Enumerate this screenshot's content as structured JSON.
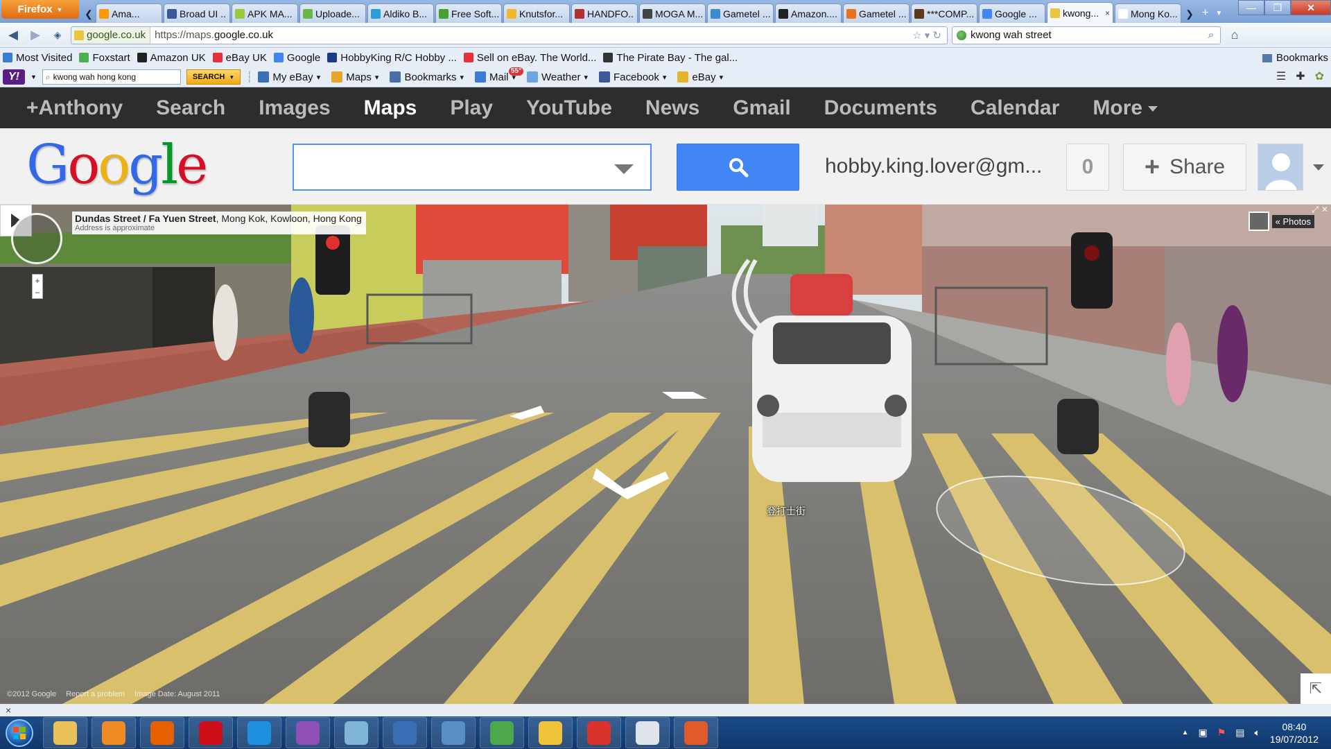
{
  "browser": {
    "app_menu_label": "Firefox",
    "tabs": [
      {
        "label": "Ama...",
        "icon": "amazon-icon",
        "color": "#f90"
      },
      {
        "label": "Broad UI ...",
        "icon": "facebook-icon",
        "color": "#3b5998"
      },
      {
        "label": "APK MA...",
        "icon": "android-icon",
        "color": "#9bc93c"
      },
      {
        "label": "Uploade...",
        "icon": "upload-icon",
        "color": "#6cb644"
      },
      {
        "label": "Aldiko B...",
        "icon": "play-store-icon",
        "color": "#2a9fd6"
      },
      {
        "label": "Free Soft...",
        "icon": "check-icon",
        "color": "#4aa02c"
      },
      {
        "label": "Knutsfor...",
        "icon": "shield-icon",
        "color": "#f3b82a"
      },
      {
        "label": "HANDFO...",
        "icon": "scissors-icon",
        "color": "#b03030"
      },
      {
        "label": "MOGA M...",
        "icon": "moga-icon",
        "color": "#444"
      },
      {
        "label": "Gametel ...",
        "icon": "gamepad-icon",
        "color": "#3a8bd0"
      },
      {
        "label": "Amazon....",
        "icon": "amazon-icon",
        "color": "#222"
      },
      {
        "label": "Gametel ...",
        "icon": "square-icon",
        "color": "#e8731a"
      },
      {
        "label": "***COMP...",
        "icon": "comp-icon",
        "color": "#5a3a1a"
      },
      {
        "label": "Google ...",
        "icon": "google-icon",
        "color": "#4285f4"
      },
      {
        "label": "kwong...",
        "icon": "maps-icon",
        "color": "#e8c640",
        "active": true,
        "close": "×"
      },
      {
        "label": "Mong Ko...",
        "icon": "wikipedia-icon",
        "color": "#fff"
      }
    ],
    "url_site": "google.co.uk",
    "url_prefix": "https://maps.",
    "url_domain": "google.co.uk",
    "search_value": "kwong wah street",
    "bookmarks": [
      {
        "label": "Most Visited",
        "color": "#3a7bd5"
      },
      {
        "label": "Foxstart",
        "color": "#4caf50"
      },
      {
        "label": "Amazon UK",
        "color": "#222"
      },
      {
        "label": "eBay UK",
        "color": "#e53238"
      },
      {
        "label": "Google",
        "color": "#4285f4"
      },
      {
        "label": "HobbyKing R/C Hobby ...",
        "color": "#1a3a8a"
      },
      {
        "label": "Sell on eBay. The World...",
        "color": "#e53238"
      },
      {
        "label": "The Pirate Bay - The gal...",
        "color": "#333"
      }
    ],
    "bookmarks_menu": "Bookmarks",
    "yahoo": {
      "logo": "Y!",
      "search_value": "kwong wah  hong kong",
      "search_button": "SEARCH",
      "items": [
        {
          "label": "My eBay",
          "color": "#3b6fb6"
        },
        {
          "label": "Maps",
          "color": "#e4a72a"
        },
        {
          "label": "Bookmarks",
          "color": "#4a6fa8"
        },
        {
          "label": "Mail",
          "color": "#3a7bd5"
        },
        {
          "label": "Weather",
          "color": "#6aa6e6"
        },
        {
          "label": "Facebook",
          "color": "#3b5998"
        },
        {
          "label": "eBay",
          "color": "#e5b22a"
        }
      ],
      "weather_badge": "55°"
    }
  },
  "google": {
    "nav": [
      "+Anthony",
      "Search",
      "Images",
      "Maps",
      "Play",
      "YouTube",
      "News",
      "Gmail",
      "Documents",
      "Calendar",
      "More"
    ],
    "active_nav": "Maps",
    "logo_letters": [
      {
        "ch": "G",
        "color": "#3369e8"
      },
      {
        "ch": "o",
        "color": "#d50f25"
      },
      {
        "ch": "o",
        "color": "#eeb211"
      },
      {
        "ch": "g",
        "color": "#3369e8"
      },
      {
        "ch": "l",
        "color": "#009925"
      },
      {
        "ch": "e",
        "color": "#d50f25"
      }
    ],
    "search_value": "",
    "user_email": "hobby.king.lover@gm...",
    "notification_count": "0",
    "share_label": "Share"
  },
  "streetview": {
    "street_name": "Dundas Street / Fa Yuen Street",
    "locality": ", Mong Kok, Kowloon, Hong Kong",
    "address_note": "Address is approximate",
    "photos_label": "« Photos",
    "footer": [
      "©2012 Google",
      "Report a problem",
      "Image Date: August 2011"
    ],
    "road_label": "登打士街"
  },
  "status": {
    "close_label": "×"
  },
  "taskbar": {
    "apps": [
      {
        "name": "explorer-icon",
        "color": "#e9c35a"
      },
      {
        "name": "media-player-icon",
        "color": "#f08a24"
      },
      {
        "name": "firefox-icon",
        "color": "#e66000"
      },
      {
        "name": "opera-icon",
        "color": "#cc0f16"
      },
      {
        "name": "internet-explorer-icon",
        "color": "#1e90e0"
      },
      {
        "name": "onenote-icon",
        "color": "#8e4fb6"
      },
      {
        "name": "notes-icon",
        "color": "#7fb5d6"
      },
      {
        "name": "wordpad-icon",
        "color": "#3a6fb6"
      },
      {
        "name": "photo-viewer-icon",
        "color": "#5a8fc6"
      },
      {
        "name": "help-icon",
        "color": "#4ca84c"
      },
      {
        "name": "paint-icon",
        "color": "#f0c43a"
      },
      {
        "name": "sync-icon",
        "color": "#d8322a"
      },
      {
        "name": "calculator-icon",
        "color": "#e0e4ea"
      },
      {
        "name": "eye-icon",
        "color": "#e05a2a"
      }
    ],
    "time": "08:40",
    "date": "19/07/2012"
  }
}
